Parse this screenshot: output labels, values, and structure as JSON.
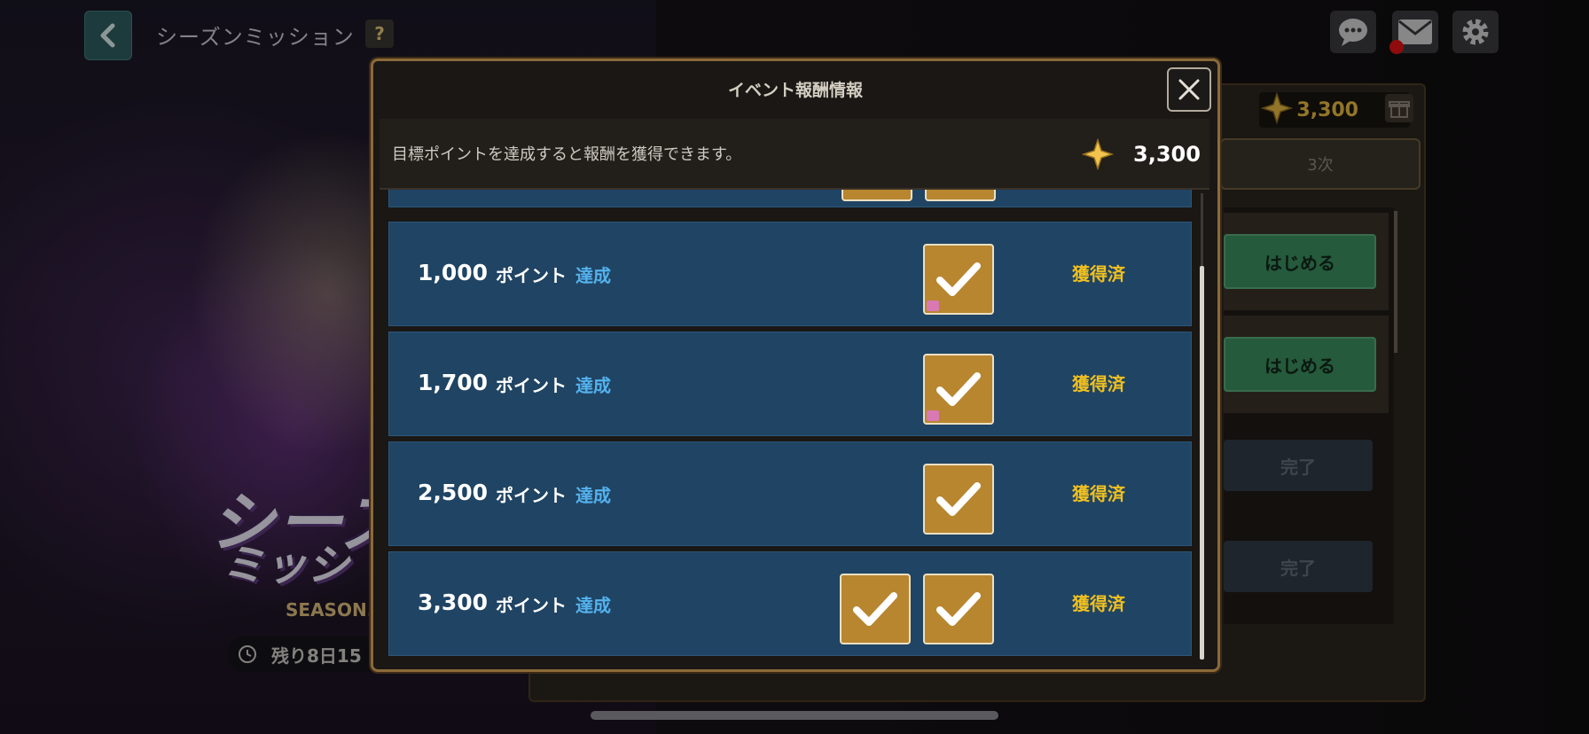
{
  "topbar": {
    "title": "シーズンミッション",
    "help": "?"
  },
  "promo": {
    "big_text": "シーズ",
    "sub_text": "ミッシ",
    "season_label": "SEASON.",
    "timer_text": "残り8日15"
  },
  "right_panel": {
    "points": "3,300",
    "tab_label": "3次",
    "buttons": [
      "はじめる",
      "はじめる",
      "完了",
      "完了"
    ]
  },
  "modal": {
    "title": "イベント報酬情報",
    "description": "目標ポイントを達成すると報酬を獲得できます。",
    "current_points": "3,300",
    "rows": [
      {
        "points": "1,000",
        "label": "ポイント",
        "status": "達成",
        "claimed": "獲得済",
        "item_count": 1
      },
      {
        "points": "1,700",
        "label": "ポイント",
        "status": "達成",
        "claimed": "獲得済",
        "item_count": 1
      },
      {
        "points": "2,500",
        "label": "ポイント",
        "status": "達成",
        "claimed": "獲得済",
        "item_count": 1
      },
      {
        "points": "3,300",
        "label": "ポイント",
        "status": "達成",
        "claimed": "獲得済",
        "item_count": 2
      }
    ]
  },
  "icons": [
    "back-arrow-icon",
    "chat-icon",
    "mail-icon",
    "gear-icon",
    "star-icon",
    "gift-icon",
    "close-icon",
    "check-icon",
    "clock-icon"
  ],
  "colors": {
    "row_bg": "#204463",
    "achieved_blue": "#54b2ee",
    "claimed_gold": "#f0c020",
    "start_green": "#3a8a5c"
  }
}
